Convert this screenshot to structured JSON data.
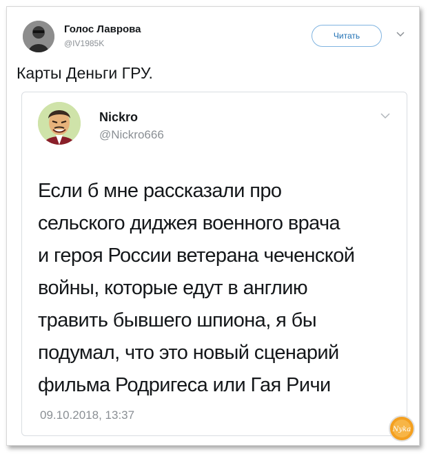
{
  "tweet": {
    "author_name": "Голос Лаврова",
    "author_handle": "@IV1985K",
    "follow_label": "Читать",
    "text": "Карты Деньги ГРУ."
  },
  "quoted": {
    "name": "Nickro",
    "handle": "@Nickro666",
    "lines": [
      "Если б мне рассказали про",
      "сельского диджея военного врача",
      "и героя России ветерана чеченской",
      "войны, которые едут в англию",
      "травить бывшего шпиона, я бы",
      "подумал, что это новый сценарий",
      "фильма Родригеса или Гая Ричи"
    ],
    "date": "09.10.2018, 13:37"
  },
  "watermark": {
    "text": "Nyka"
  },
  "colors": {
    "link_blue": "#1d6fb3",
    "muted_gray": "#8a8f94",
    "text": "#14171a",
    "watermark_orange": "#f4a020"
  },
  "icons": {
    "caret": "chevron-down-icon"
  }
}
